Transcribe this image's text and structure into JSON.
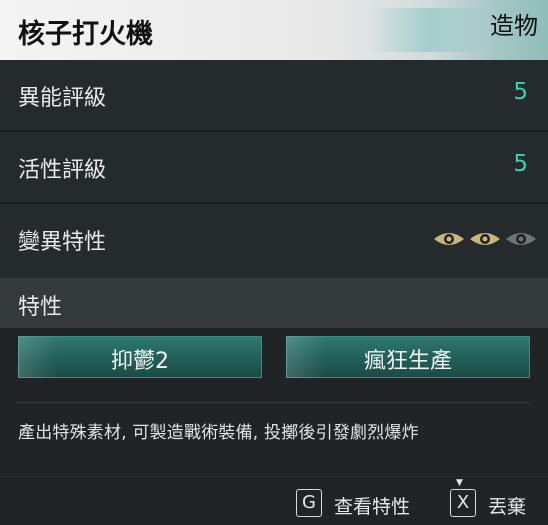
{
  "header": {
    "title": "核子打火機",
    "category": "造物"
  },
  "stats": [
    {
      "label": "異能評級",
      "value": "5"
    },
    {
      "label": "活性評級",
      "value": "5"
    }
  ],
  "mutation": {
    "label": "變異特性",
    "level": 2,
    "max": 3,
    "active_color": "#c7b67a",
    "inactive_color": "#6f7376"
  },
  "traits": {
    "label": "特性",
    "items": [
      "抑鬱2",
      "瘋狂生產"
    ],
    "description": "產出特殊素材, 可製造戰術裝備, 投擲後引發劇烈爆炸"
  },
  "actions": {
    "view": {
      "key": "G",
      "label": "查看特性"
    },
    "discard": {
      "key": "X",
      "label": "丟棄"
    }
  },
  "colors": {
    "accent": "#38d1b6",
    "chip": "#2a6b64"
  }
}
